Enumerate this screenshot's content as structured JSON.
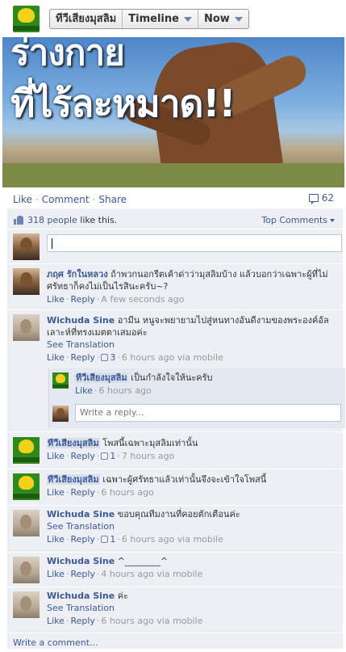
{
  "header": {
    "page_name": "ทีวีเสียงมุสลิม",
    "timeline_label": "Timeline",
    "now_label": "Now"
  },
  "photo": {
    "line1": "ร่างกาย",
    "line2": "ที่ไร้ละหมาด!!"
  },
  "actions": {
    "like": "Like",
    "comment": "Comment",
    "share": "Share",
    "comment_count": "62"
  },
  "likes": {
    "people_count": "318 people",
    "suffix": "like this.",
    "top_comments": "Top Comments"
  },
  "comments": [
    {
      "author": "ภฤศ รักในหลวง",
      "text": "ถ้าพวกนอกรีตเค้าด่าว่ามุสลิมบ้าง แล้วบอกว่าเฉพาะผู้ที่ไม่ศรัทธาก็คงไม่เป็นไรสินะครับ~?",
      "like": "Like",
      "reply": "Reply",
      "time": "A few seconds ago"
    },
    {
      "author": "Wichuda Sine",
      "text": "อามีน หนูจะพยายามไปสู่หนทางอันดีงามของพระองค์อัลเลาะห์ที่ทรงเมตตาเสมอค่ะ",
      "see_translation": "See Translation",
      "like": "Like",
      "reply": "Reply",
      "likes": "3",
      "time": "6 hours ago via mobile",
      "reply_item": {
        "author": "ทีวีเสียงมุสลิม",
        "text": "เป็นกำลังใจให้นะครับ",
        "like": "Like",
        "time": "6 hours ago"
      },
      "reply_placeholder": "Write a reply..."
    },
    {
      "author": "ทีวีเสียงมุสลิม",
      "text": "โพสนี้เฉพาะมุสลิมเท่านั้น",
      "like": "Like",
      "reply": "Reply",
      "likes": "1",
      "time": "7 hours ago"
    },
    {
      "author": "ทีวีเสียงมุสลิม",
      "text": "เฉพาะผู้ศรัทธาแล้วเท่านั้นจึงจะเข้าใจโพสนี้",
      "like": "Like",
      "reply": "Reply",
      "time": "6 hours ago"
    },
    {
      "author": "Wichuda Sine",
      "text": "ขอบคุณทีมงานที่คอยตักเตือนค่ะ",
      "see_translation": "See Translation",
      "like": "Like",
      "reply": "Reply",
      "likes": "1",
      "time": "6 hours ago via mobile"
    },
    {
      "author": "Wichuda Sine",
      "text": "^________^",
      "like": "Like",
      "reply": "Reply",
      "time": "4 hours ago via mobile"
    },
    {
      "author": "Wichuda Sine",
      "text": "ค่ะ",
      "see_translation": "See Translation",
      "like": "Like",
      "reply": "Reply",
      "time": "6 hours ago via mobile"
    }
  ],
  "write_comment": "Write a comment..."
}
